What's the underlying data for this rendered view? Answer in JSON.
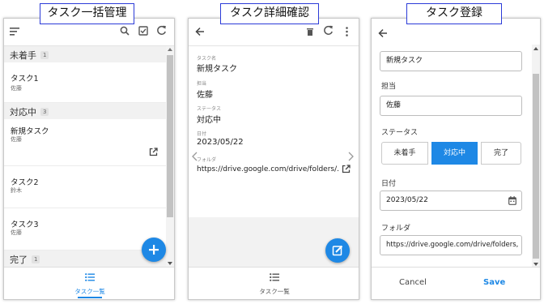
{
  "callouts": {
    "list": "タスク一括管理",
    "detail": "タスク詳細確認",
    "register": "タスク登録"
  },
  "list_screen": {
    "sections": [
      {
        "title": "未着手",
        "count": "1"
      },
      {
        "title": "対応中",
        "count": "3"
      },
      {
        "title": "完了",
        "count": "1"
      }
    ],
    "items": [
      {
        "title": "タスク1",
        "assignee": "佐藤"
      },
      {
        "title": "新規タスク",
        "assignee": "佐藤"
      },
      {
        "title": "タスク2",
        "assignee": "鈴木"
      },
      {
        "title": "タスク3",
        "assignee": "佐藤"
      }
    ],
    "nav_label": "タスク一覧",
    "scroll_position": 0.05,
    "icons": [
      "sort-icon",
      "search-icon",
      "checkbox-icon",
      "refresh-icon",
      "add-icon",
      "list-icon",
      "open-external-icon"
    ],
    "accent": "#1e88e5"
  },
  "detail_screen": {
    "fields": {
      "name_label": "タスク名",
      "name": "新規タスク",
      "assignee_label": "担当",
      "assignee": "佐藤",
      "status_label": "ステータス",
      "status": "対応中",
      "date_label": "日付",
      "date": "2023/05/22",
      "folder_label": "フォルダ",
      "folder": "https://drive.google.com/drive/folders/..."
    },
    "nav_label": "タスク一覧",
    "icons": [
      "back-arrow-icon",
      "delete-icon",
      "refresh-icon",
      "more-vert-icon",
      "chevron-left-icon",
      "chevron-right-icon",
      "open-external-icon",
      "edit-icon",
      "list-icon"
    ]
  },
  "register_screen": {
    "task_name_value": "新規タスク",
    "assignee_label": "担当",
    "assignee_value": "佐藤",
    "status_label": "ステータス",
    "status_options": [
      "未着手",
      "対応中",
      "完了"
    ],
    "status_selected": "対応中",
    "date_label": "日付",
    "date_value": "2023/05/22",
    "folder_label": "フォルダ",
    "folder_value": "https://drive.google.com/drive/folders,",
    "cancel_label": "Cancel",
    "save_label": "Save",
    "icons": [
      "back-arrow-icon",
      "calendar-icon"
    ]
  }
}
